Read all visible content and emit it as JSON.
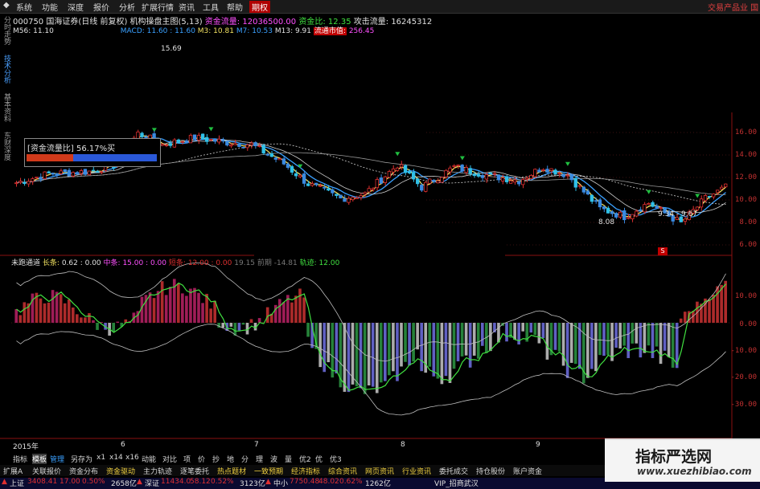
{
  "menu": {
    "items": [
      "系统",
      "功能",
      "深度",
      "报价",
      "分析",
      "扩展行情",
      "资讯",
      "工具",
      "帮助"
    ],
    "active": "期权",
    "right_text": "交易产品业   国"
  },
  "side_tabs": [
    "分时走势",
    "技术分析",
    "基本资料",
    "东财深度"
  ],
  "header": {
    "code": "000750",
    "title": "国海证券(日线 前复权) 机构操盘主图(5,13)",
    "fund_flow_label": "资金流量:",
    "fund_flow_value": "12036500.00",
    "fund_ratio_label": "资金比:",
    "fund_ratio_value": "12.35",
    "attack_label": "攻击流量:",
    "attack_value": "16245312",
    "line2_ma": "M56: 11.10",
    "line2_macd": "MACD: 11.60 : 11.60",
    "line2_m3": "M3: 10.81",
    "line2_m7": "M7: 10.53",
    "line2_m13": "M13: 9.91",
    "line2_circ_label": "流通市值:",
    "line2_circ_value": "256.45",
    "peak_label": "15.69",
    "low_label": "8.08",
    "range_label": "9.34 - 9.67"
  },
  "fund_panel": {
    "title": "[资金流量比] 56.17%买",
    "buy_pct": 56.17
  },
  "main_axis": {
    "ticks": [
      "16.00",
      "14.00",
      "12.00",
      "10.00",
      "8.00",
      "6.00"
    ]
  },
  "indicator": {
    "name": "未跑通道",
    "long_label": "长条:",
    "long_value": "0.62 : 0.00",
    "mid_label": "中条:",
    "mid_value": "15.00 : 0.00",
    "short_label": "短条:",
    "short_value": "12.00 : 0.00",
    "misc": "19.15  前期 -14.81",
    "trend_label": "轨迹:",
    "trend_value": "12.00",
    "ticks": [
      "10.00",
      "0.00",
      "-10.00",
      "-20.00",
      "-30.00"
    ],
    "badge": "S"
  },
  "time_axis": [
    "2015年",
    "6",
    "7",
    "8",
    "9"
  ],
  "bottom_row1": [
    "指标",
    "模板",
    "管理",
    "另存为",
    "x1",
    "x14",
    "x16",
    "动能",
    "对比",
    "项",
    "价",
    "抄",
    "地",
    "分",
    "理",
    "波",
    "量",
    "优2",
    "优",
    "优3"
  ],
  "bottom_row2": [
    "扩展A",
    "关联报价",
    "资金分布",
    "资金驱动",
    "主力轨迹",
    "逐笔委托",
    "热点题材",
    "一致预期",
    "经济指标",
    "综合资讯",
    "网页资讯",
    "行业资讯",
    "委托成交",
    "持仓股份",
    "账户资金"
  ],
  "status": {
    "sh_label": "上证",
    "sh_value": "3408.41",
    "sh_chg": "17.00",
    "sh_pct": "0.50%",
    "sh_amt": "2658亿",
    "sz_label": "深证",
    "sz_value": "11434.0",
    "sz_chg": "58.12",
    "sz_pct": "0.52%",
    "sz_amt": "3123亿",
    "zx_label": "中小",
    "zx_value": "7750.48",
    "zx_chg": "48.02",
    "zx_pct": "0.62%",
    "zx_amt": "1262亿",
    "vip": "VIP_招商武汉"
  },
  "watermark": {
    "title": "指标严选网",
    "url": "www.xuezhibiao.com"
  },
  "colors": {
    "up": "#e03030",
    "down": "#40c0e0",
    "green": "#20a040",
    "yellow": "#f0e060",
    "blue_line": "#3aa0ff"
  }
}
